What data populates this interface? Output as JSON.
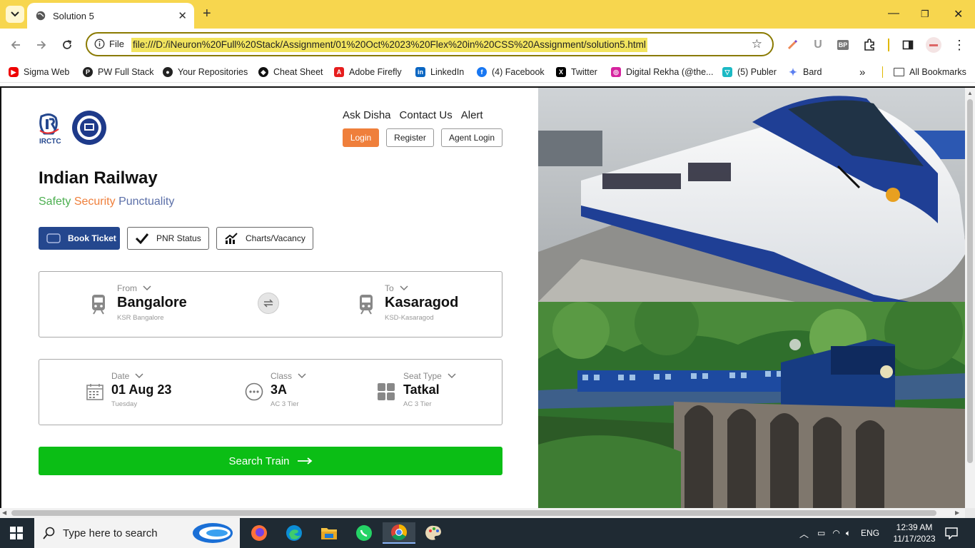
{
  "browser": {
    "tab_title": "Solution 5",
    "url_scheme_label": "File",
    "url": "file:///D:/iNeuron%20Full%20Stack/Assignment/01%20Oct%2023%20Flex%20in%20CSS%20Assignment/solution5.html",
    "bookmarks": [
      "Sigma Web",
      "PW Full Stack",
      "Your Repositories",
      "Cheat Sheet",
      "Adobe Firefly",
      "LinkedIn",
      "(4) Facebook",
      "Twitter",
      "Digital Rekha (@the...",
      "(5) Publer",
      "Bard"
    ],
    "all_bookmarks": "All Bookmarks",
    "colors": {
      "frame": "#f7d64e",
      "url_highlight": "#f2e45e"
    }
  },
  "page": {
    "logo_text": "IRCTC",
    "nav": [
      "Ask Disha",
      "Contact Us",
      "Alert"
    ],
    "buttons": {
      "login": "Login",
      "register": "Register",
      "agent_login": "Agent Login"
    },
    "heading": "Indian Railway",
    "tagline": {
      "safety": "Safety",
      "security": "Security",
      "punctuality": "Punctuality"
    },
    "tabs": {
      "book": "Book Ticket",
      "pnr": "PNR Status",
      "charts": "Charts/Vacancy"
    },
    "from": {
      "label": "From",
      "value": "Bangalore",
      "sub": "KSR Bangalore"
    },
    "to": {
      "label": "To",
      "value": "Kasaragod",
      "sub": "KSD-Kasaragod"
    },
    "date": {
      "label": "Date",
      "value": "01 Aug 23",
      "sub": "Tuesday"
    },
    "class": {
      "label": "Class",
      "value": "3A",
      "sub": "AC 3 Tier"
    },
    "seat": {
      "label": "Seat Type",
      "value": "Tatkal",
      "sub": "AC 3 Tier"
    },
    "search": "Search Train",
    "colors": {
      "accent_orange": "#ef7f3b",
      "primary_blue": "#24478e",
      "search_green": "#0bbe15"
    }
  },
  "taskbar": {
    "search_placeholder": "Type here to search",
    "lang": "ENG",
    "time": "12:39 AM",
    "date": "11/17/2023"
  }
}
